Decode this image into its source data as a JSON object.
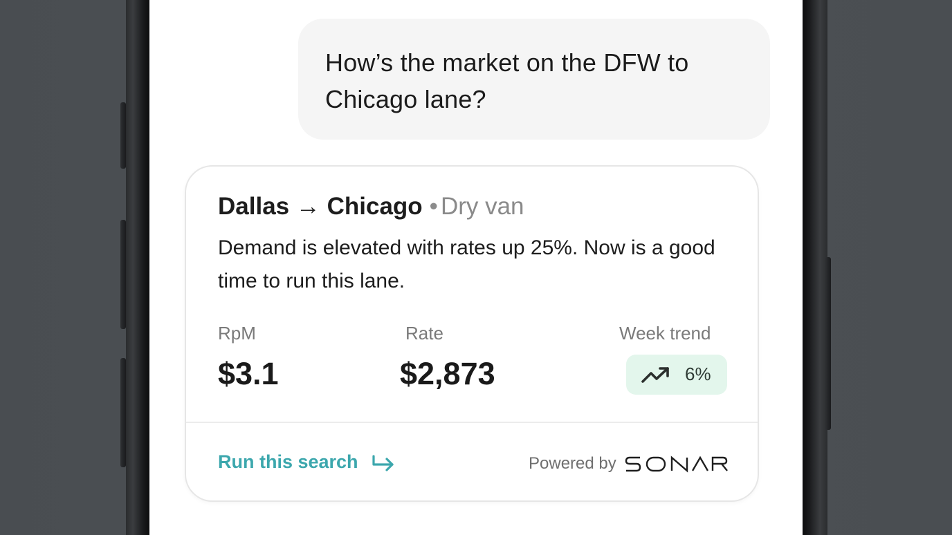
{
  "chat": {
    "user_message": "How’s the market on the DFW to Chicago lane?"
  },
  "card": {
    "origin": "Dallas",
    "arrow": "→",
    "destination": "Chicago",
    "separator": "•",
    "equipment": "Dry van",
    "description": "Demand is elevated with rates up 25%. Now is a good time to run this lane.",
    "metrics": {
      "rpm_label": "RpM",
      "rpm_value": "$3.1",
      "rate_label": "Rate",
      "rate_value": "$2,873",
      "trend_label": "Week trend",
      "trend_value": "6%",
      "trend_icon": "trending-up-icon"
    },
    "footer": {
      "run_search_label": "Run this search",
      "run_search_icon": "arrow-return-right-icon",
      "powered_by_label": "Powered by",
      "brand": "SONAR"
    }
  },
  "colors": {
    "link": "#3ca7ad",
    "trend_badge_bg": "#e3f6ec",
    "bubble_bg": "#f5f5f5"
  }
}
